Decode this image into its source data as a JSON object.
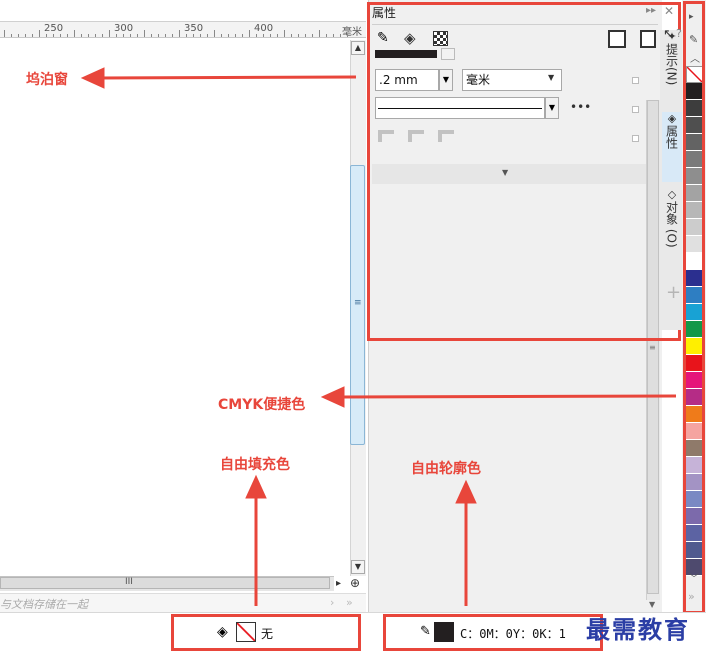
{
  "ruler": {
    "ticks": [
      "250",
      "300",
      "350",
      "400"
    ],
    "unit": "毫米"
  },
  "canvas": {
    "tip": "与文档存储在一起",
    "hscroll_grip": "III",
    "vscroll_grip": "≡"
  },
  "docker": {
    "title": "属性",
    "outline_width": ".2 mm",
    "units": "毫米",
    "more": "•••",
    "expand": "▼"
  },
  "vertical_tabs": [
    {
      "label": "提示(N)"
    },
    {
      "label": "属性"
    },
    {
      "label": "对象 (O)"
    }
  ],
  "palette": {
    "swatches": [
      "#ffffff",
      "#231f20",
      "#3d3d3d",
      "#4f4f4f",
      "#636363",
      "#7a7a7a",
      "#8e8e8e",
      "#a3a3a3",
      "#b7b7b7",
      "#cccccc",
      "#e0e0e0",
      "#ffffff",
      "#2b2f8f",
      "#2e7ec2",
      "#18a2d4",
      "#139848",
      "#ffef00",
      "#e8141b",
      "#e5157a",
      "#b52c86",
      "#ef7b1a",
      "#f5a4a0",
      "#8f7a6a",
      "#c6b3d8",
      "#a393c4",
      "#7a89c3",
      "#7c6aab",
      "#5c63a3",
      "#505a8f",
      "#4e4a6e"
    ]
  },
  "status": {
    "fill_label": "无",
    "outline_label": "C：0M：0Y：0K：1"
  },
  "annotations": {
    "docker": "坞泊窗",
    "cmyk": "CMYK便捷色",
    "fill": "自由填充色",
    "outline": "自由轮廓色"
  },
  "watermark": "最需教育",
  "colors": {
    "annotation_red": "#e8463b",
    "accent_blue": "#2b3ea5"
  }
}
